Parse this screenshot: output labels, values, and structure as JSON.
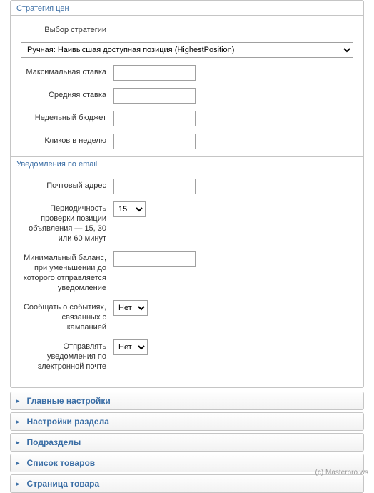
{
  "sections": {
    "pricing": {
      "title": "Стратегия цен",
      "strategy_label": "Выбор стратегии",
      "strategy_value": "Ручная: Наивысшая доступная позиция (HighestPosition)",
      "max_bid_label": "Максимальная ставка",
      "max_bid_value": "",
      "avg_bid_label": "Средняя ставка",
      "avg_bid_value": "",
      "weekly_budget_label": "Недельный бюджет",
      "weekly_budget_value": "",
      "clicks_week_label": "Кликов в неделю",
      "clicks_week_value": ""
    },
    "email": {
      "title": "Уведомления по email",
      "address_label": "Почтовый адрес",
      "address_value": "",
      "interval_label": "Периодичность проверки позиции объявления — 15, 30 или 60 минут",
      "interval_value": "15",
      "balance_label": "Минимальный баланс, при уменьшении до которого отправляется уведомление",
      "balance_value": "",
      "events_label": "Сообщать о событиях, связанных с кампанией",
      "events_value": "Нет",
      "send_label": "Отправлять уведомления по электронной почте",
      "send_value": "Нет"
    }
  },
  "accordion": {
    "main": "Главные настройки",
    "section": "Настройки раздела",
    "subsections": "Подразделы",
    "products": "Список товаров",
    "product_page": "Страница товара"
  },
  "footer": "(с) Masterpro.ws"
}
